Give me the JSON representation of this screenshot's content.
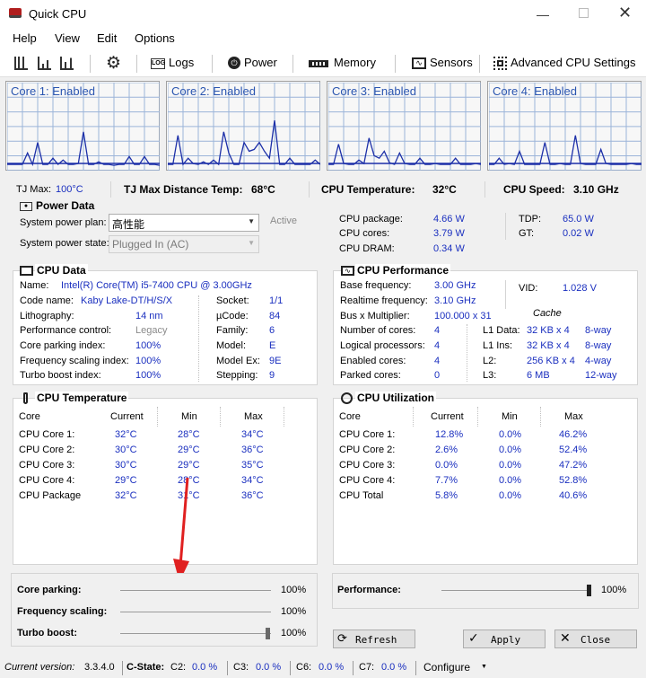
{
  "window": {
    "title": "Quick CPU"
  },
  "menu": [
    "Help",
    "View",
    "Edit",
    "Options"
  ],
  "toolbar": {
    "logs": "Logs",
    "power": "Power",
    "memory": "Memory",
    "sensors": "Sensors",
    "advanced": "Advanced CPU Settings"
  },
  "cores": [
    {
      "label": "Core 1: Enabled",
      "load": [
        0.05,
        0.05,
        0.05,
        0.05,
        0.18,
        0.05,
        0.3,
        0.05,
        0.05,
        0.12,
        0.05,
        0.1,
        0.05,
        0.05,
        0.06,
        0.42,
        0.05,
        0.05,
        0.08,
        0.05,
        0.05,
        0.04,
        0.05,
        0.05,
        0.14,
        0.05,
        0.05,
        0.14,
        0.05,
        0.05,
        0.04
      ]
    },
    {
      "label": "Core 2: Enabled",
      "load": [
        0.05,
        0.05,
        0.38,
        0.05,
        0.12,
        0.06,
        0.05,
        0.08,
        0.05,
        0.1,
        0.05,
        0.42,
        0.18,
        0.05,
        0.05,
        0.3,
        0.2,
        0.22,
        0.3,
        0.2,
        0.12,
        0.55,
        0.05,
        0.05,
        0.12,
        0.05,
        0.05,
        0.05,
        0.05,
        0.1,
        0.05
      ]
    },
    {
      "label": "Core 3: Enabled",
      "load": [
        0.05,
        0.05,
        0.28,
        0.06,
        0.05,
        0.05,
        0.1,
        0.06,
        0.35,
        0.15,
        0.12,
        0.2,
        0.07,
        0.05,
        0.18,
        0.06,
        0.05,
        0.05,
        0.12,
        0.05,
        0.05,
        0.06,
        0.05,
        0.05,
        0.05,
        0.12,
        0.05,
        0.05,
        0.05,
        0.06,
        0.05
      ]
    },
    {
      "label": "Core 4: Enabled",
      "load": [
        0.05,
        0.05,
        0.12,
        0.05,
        0.06,
        0.05,
        0.2,
        0.05,
        0.05,
        0.05,
        0.05,
        0.3,
        0.05,
        0.05,
        0.06,
        0.05,
        0.05,
        0.38,
        0.06,
        0.05,
        0.05,
        0.05,
        0.22,
        0.06,
        0.05,
        0.05,
        0.05,
        0.05,
        0.06,
        0.05,
        0.05
      ]
    }
  ],
  "temps_row": {
    "tjmax_label": "TJ Max:",
    "tjmax_value": "100°C",
    "dist_label": "TJ Max Distance Temp:",
    "dist_value": "68°C",
    "cputemp_label": "CPU Temperature:",
    "cputemp_value": "32°C",
    "speed_label": "CPU Speed:",
    "speed_value": "3.10 GHz"
  },
  "power": {
    "title": "Power Data",
    "plan_label": "System power plan:",
    "plan_value": "高性能",
    "plan_status": "Active",
    "state_label": "System power state:",
    "state_value": "Plugged In (AC)",
    "left": [
      [
        "CPU package:",
        "4.66 W"
      ],
      [
        "CPU cores:",
        "3.79 W"
      ],
      [
        "CPU DRAM:",
        "0.34 W"
      ]
    ],
    "right": [
      [
        "TDP:",
        "65.0 W"
      ],
      [
        "GT:",
        "0.02 W"
      ]
    ]
  },
  "cpu_data": {
    "title": "CPU Data",
    "name_label": "Name:",
    "name_value": "Intel(R) Core(TM) i5-7400 CPU @ 3.00GHz",
    "left": [
      [
        "Code name:",
        "Kaby Lake-DT/H/S/X"
      ],
      [
        "Lithography:",
        "14 nm"
      ],
      [
        "Performance control:",
        "Legacy"
      ],
      [
        "Core parking index:",
        "100%"
      ],
      [
        "Frequency scaling index:",
        "100%"
      ],
      [
        "Turbo boost index:",
        "100%"
      ]
    ],
    "right": [
      [
        "Socket:",
        "1/1"
      ],
      [
        "µCode:",
        "84"
      ],
      [
        "Family:",
        "6"
      ],
      [
        "Model:",
        "E"
      ],
      [
        "Model Ex:",
        "9E"
      ],
      [
        "Stepping:",
        "9"
      ]
    ]
  },
  "cpu_perf": {
    "title": "CPU Performance",
    "base_label": "Base frequency:",
    "base_value": "3.00 GHz",
    "vid_label": "VID:",
    "vid_value": "1.028 V",
    "rt_label": "Realtime frequency:",
    "rt_value": "3.10 GHz",
    "bus_label": "Bus x Multiplier:",
    "bus_value": "100.000 x 31",
    "cache_label": "Cache",
    "rows": [
      [
        "Number of cores:",
        "4",
        "L1 Data:",
        "32 KB x 4",
        "8-way"
      ],
      [
        "Logical processors:",
        "4",
        "L1 Ins:",
        "32 KB x 4",
        "8-way"
      ],
      [
        "Enabled cores:",
        "4",
        "L2:",
        "256 KB x 4",
        "4-way"
      ],
      [
        "Parked cores:",
        "0",
        "L3:",
        "6 MB",
        "12-way"
      ]
    ]
  },
  "cpu_temp": {
    "title": "CPU Temperature",
    "headers": [
      "Core",
      "Current",
      "Min",
      "Max"
    ],
    "rows": [
      [
        "CPU Core 1:",
        "32°C",
        "28°C",
        "34°C"
      ],
      [
        "CPU Core 2:",
        "30°C",
        "29°C",
        "36°C"
      ],
      [
        "CPU Core 3:",
        "30°C",
        "29°C",
        "35°C"
      ],
      [
        "CPU Core 4:",
        "29°C",
        "28°C",
        "34°C"
      ],
      [
        "CPU Package",
        "32°C",
        "31°C",
        "36°C"
      ]
    ]
  },
  "cpu_util": {
    "title": "CPU Utilization",
    "headers": [
      "Core",
      "Current",
      "Min",
      "Max"
    ],
    "rows": [
      [
        "CPU Core 1:",
        "12.8%",
        "0.0%",
        "46.2%"
      ],
      [
        "CPU Core 2:",
        "2.6%",
        "0.0%",
        "52.4%"
      ],
      [
        "CPU Core 3:",
        "0.0%",
        "0.0%",
        "47.2%"
      ],
      [
        "CPU Core 4:",
        "7.7%",
        "0.0%",
        "52.8%"
      ],
      [
        "CPU Total",
        "5.8%",
        "0.0%",
        "40.6%"
      ]
    ]
  },
  "sliders": {
    "parking_label": "Core parking:",
    "parking_value": "100%",
    "scaling_label": "Frequency scaling:",
    "scaling_value": "100%",
    "turbo_label": "Turbo boost:",
    "turbo_value": "100%",
    "perf_label": "Performance:",
    "perf_value": "100%"
  },
  "buttons": {
    "refresh": "Refresh",
    "apply": "Apply",
    "close": "Close"
  },
  "status": {
    "version_label": "Current version:",
    "version_value": "3.3.4.0",
    "cstate_label": "C-State:",
    "c2_label": "C2:",
    "c2_value": "0.0 %",
    "c3_label": "C3:",
    "c3_value": "0.0 %",
    "c6_label": "C6:",
    "c6_value": "0.0 %",
    "c7_label": "C7:",
    "c7_value": "0.0 %",
    "configure": "Configure"
  },
  "colors": {
    "graph_line": "#1c2fa8",
    "graph_grid": "#9bb4d9",
    "value_blue": "#1a2fbf",
    "annotation_arrow": "#e02020"
  }
}
